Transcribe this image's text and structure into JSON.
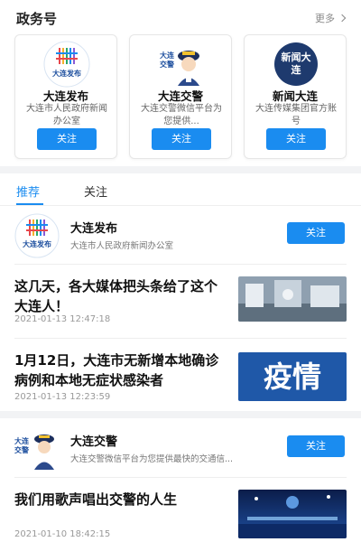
{
  "gov": {
    "title": "政务号",
    "more": "更多",
    "cards": [
      {
        "name": "大连发布",
        "desc": "大连市人民政府新闻办公室",
        "follow": "关注",
        "logo_text": "大连发布"
      },
      {
        "name": "大连交警",
        "desc": "大连交警微信平台为您提供...",
        "follow": "关注",
        "logo_text": "大连交警"
      },
      {
        "name": "新闻大连",
        "desc": "大连传媒集团官方账号",
        "follow": "关注",
        "logo_text": "新闻大连"
      }
    ]
  },
  "tabs": {
    "recommend": "推荐",
    "follow": "关注"
  },
  "feed": {
    "account1": {
      "name": "大连发布",
      "desc": "大连市人民政府新闻办公室",
      "follow": "关注",
      "logo_text": "大连发布"
    },
    "news1": {
      "title": "这几天，各大媒体把头条给了这个大连人！",
      "time": "2021-01-13 12:47:18"
    },
    "news2": {
      "title": "1月12日，大连市无新增本地确诊病例和本地无症状感染者",
      "time": "2021-01-13 12:23:59",
      "thumb_text": "疫情"
    },
    "account2": {
      "name": "大连交警",
      "desc": "大连交警微信平台为您提供最快的交通信...",
      "follow": "关注",
      "logo_text": "大连交警"
    },
    "news3": {
      "title": "我们用歌声唱出交警的人生",
      "time": "2021-01-10 18:42:15"
    }
  },
  "colors": {
    "accent": "#1a8cf0",
    "band": "#f2f3f5"
  }
}
